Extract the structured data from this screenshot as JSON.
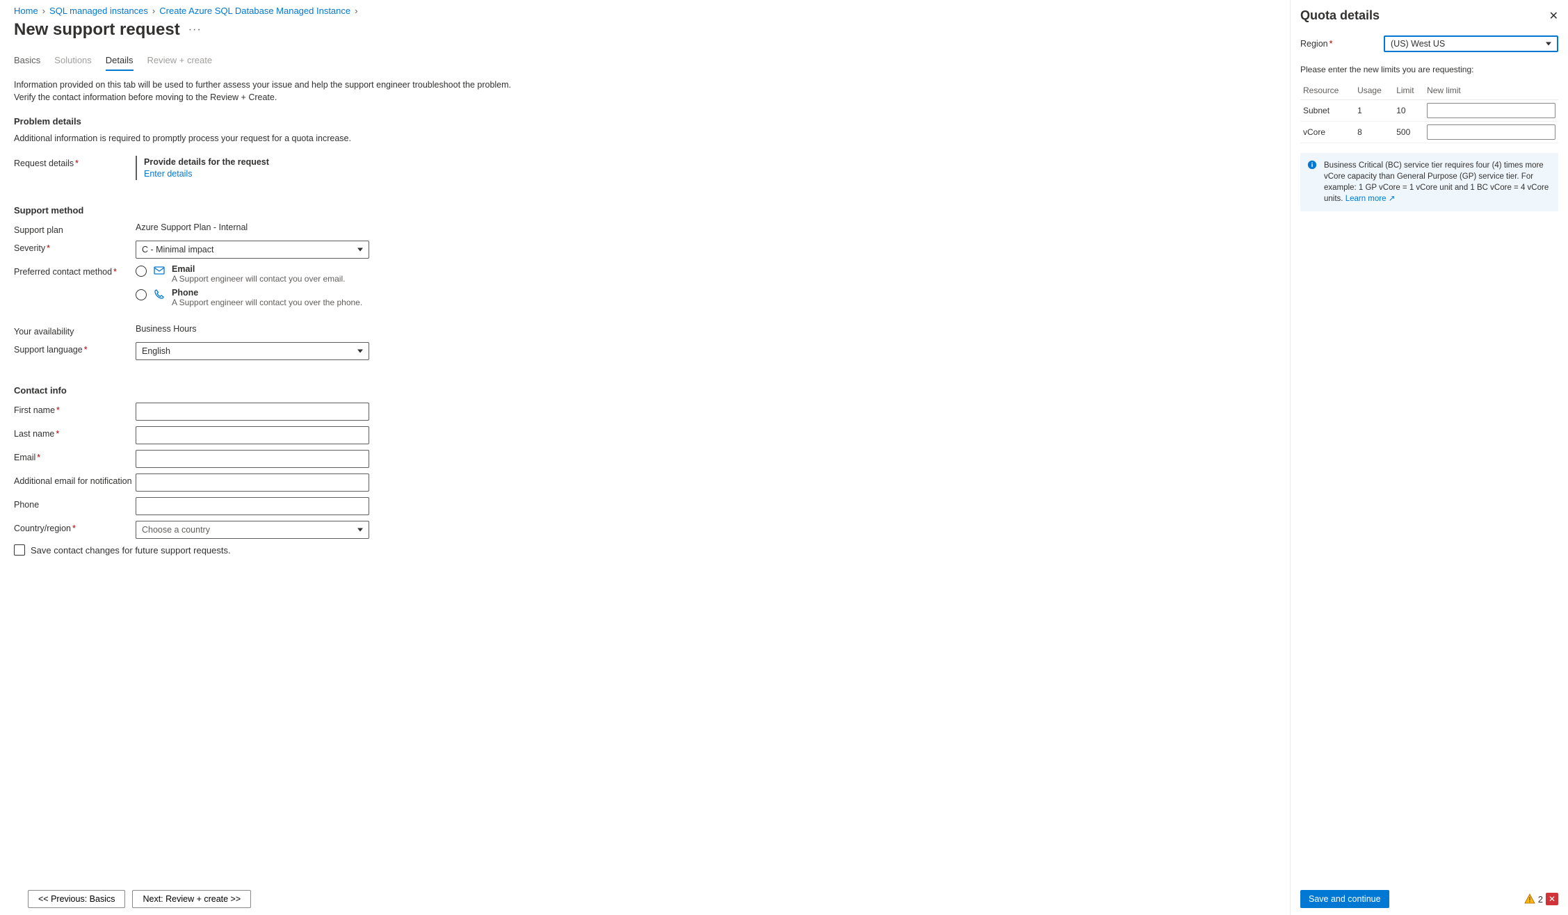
{
  "breadcrumb": {
    "home": "Home",
    "sql_mi": "SQL managed instances",
    "create": "Create Azure SQL Database Managed Instance"
  },
  "title": "New support request",
  "tabs": {
    "basics": "Basics",
    "solutions": "Solutions",
    "details": "Details",
    "review": "Review + create"
  },
  "intro": "Information provided on this tab will be used to further assess your issue and help the support engineer troubleshoot the problem. Verify the contact information before moving to the Review + Create.",
  "problem": {
    "heading": "Problem details",
    "sub": "Additional information is required to promptly process your request for a quota increase.",
    "request_details_label": "Request details",
    "provide": "Provide details for the request",
    "enter": "Enter details"
  },
  "support": {
    "heading": "Support method",
    "plan_label": "Support plan",
    "plan_value": "Azure Support Plan - Internal",
    "severity_label": "Severity",
    "severity_value": "C - Minimal impact",
    "contact_label": "Preferred contact method",
    "email": {
      "label": "Email",
      "desc": "A Support engineer will contact you over email."
    },
    "phone": {
      "label": "Phone",
      "desc": "A Support engineer will contact you over the phone."
    },
    "avail_label": "Your availability",
    "avail_value": "Business Hours",
    "lang_label": "Support language",
    "lang_value": "English"
  },
  "contact": {
    "heading": "Contact info",
    "first_name": "First name",
    "last_name": "Last name",
    "email": "Email",
    "add_email": "Additional email for notification",
    "phone": "Phone",
    "country": "Country/region",
    "country_placeholder": "Choose a country",
    "save_chk": "Save contact changes for future support requests."
  },
  "footer": {
    "prev": "<< Previous: Basics",
    "next": "Next: Review + create >>"
  },
  "panel": {
    "title": "Quota details",
    "region_label": "Region",
    "region_value": "(US) West US",
    "instruction": "Please enter the new limits you are requesting:",
    "columns": {
      "resource": "Resource",
      "usage": "Usage",
      "limit": "Limit",
      "newlimit": "New limit"
    },
    "rows": [
      {
        "resource": "Subnet",
        "usage": "1",
        "limit": "10"
      },
      {
        "resource": "vCore",
        "usage": "8",
        "limit": "500"
      }
    ],
    "info": "Business Critical (BC) service tier requires four (4) times more vCore capacity than General Purpose (GP) service tier. For example: 1 GP vCore = 1 vCore unit and 1 BC vCore = 4 vCore units. ",
    "learn_more": "Learn more",
    "save_btn": "Save and continue",
    "warn_count": "2"
  }
}
